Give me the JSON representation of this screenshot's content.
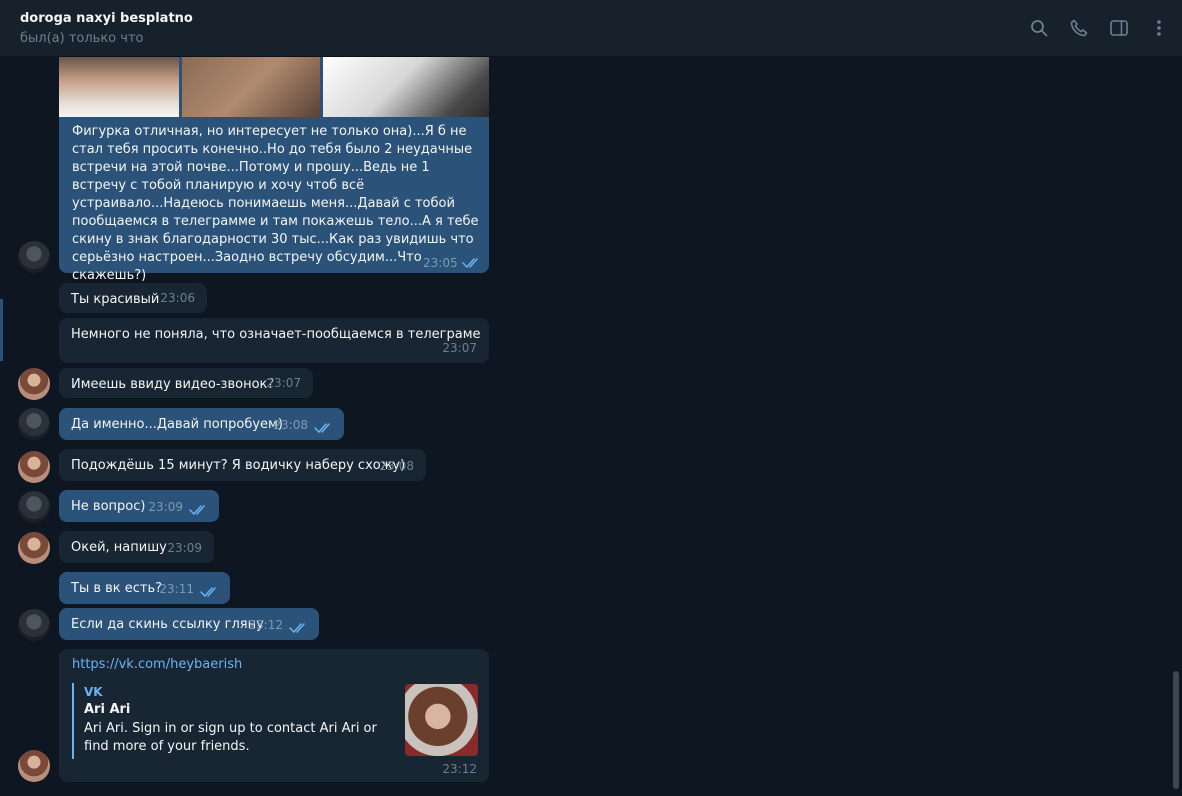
{
  "header": {
    "title": "doroga naxyi besplatno",
    "status": "был(а) только что"
  },
  "messages": {
    "big": {
      "text": "Фигурка отличная, но интересует не только она)...Я б не стал тебя просить конечно..Но до тебя было 2 неудачные встречи на этой почве...Потому и прошу...Ведь не 1 встречу с тобой планирую и хочу чтоб всё устраивало...Надеюсь понимаешь меня...Давай с тобой пообщаемся в телеграмме и там покажешь тело...А я тебе скину в знак благодарности 30 тыс...Как раз увидишь что серьёзно настроен...Заодно встречу обсудим...Что скажешь?)",
      "time": "23:05"
    },
    "m1": {
      "text": "Ты красивый",
      "time": "23:06"
    },
    "m2": {
      "text": "Немного не поняла, что означает-пообщаемся в телеграме",
      "time": "23:07"
    },
    "m3": {
      "text": "Имеешь ввиду видео-звонок?",
      "time": "23:07"
    },
    "m4": {
      "text": "Да именно...Давай попробуем)",
      "time": "23:08"
    },
    "m5": {
      "text": "Подождёшь 15 минут? Я водичку наберу схожу)",
      "time": "23:08"
    },
    "m6": {
      "text": "Не вопрос)",
      "time": "23:09"
    },
    "m7": {
      "text": "Окей, напишу",
      "time": "23:09"
    },
    "m8": {
      "text": "Ты в вк есть?",
      "time": "23:11"
    },
    "m9": {
      "text": "Если да скинь ссылку гляну",
      "time": "23:12"
    },
    "link": {
      "url": "https://vk.com/heybaerish",
      "site": "VK",
      "title": "Ari Ari",
      "description": "Ari Ari. Sign in or sign up to contact Ari Ari or find more of your friends.",
      "time": "23:12"
    }
  },
  "icons": {
    "search": "search-icon",
    "call": "phone-icon",
    "sidebar": "sidebar-toggle-icon",
    "menu": "more-vertical-icon"
  },
  "colors": {
    "background": "#0e1621",
    "header": "#17212b",
    "outgoing": "#2b5278",
    "incoming": "#182533",
    "link": "#6ab3f3"
  }
}
